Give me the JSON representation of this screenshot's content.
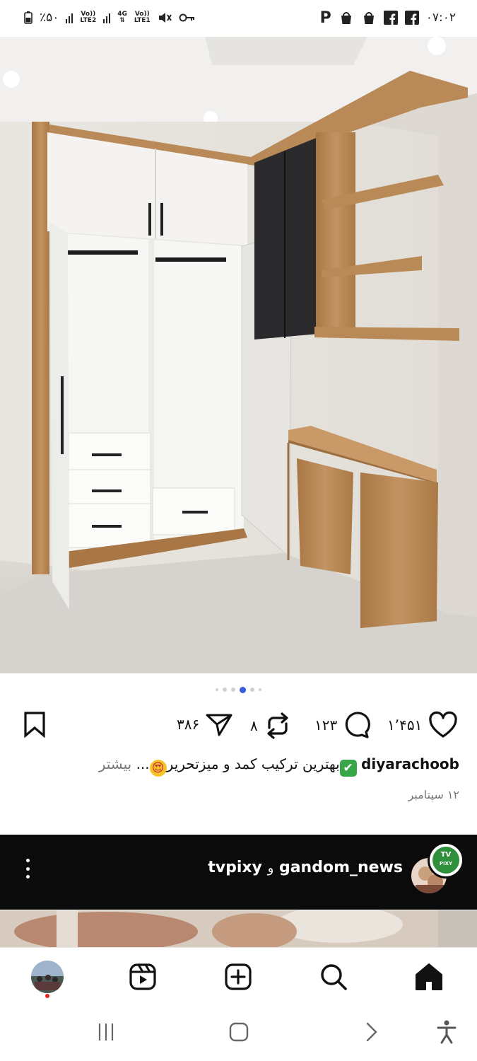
{
  "status_bar": {
    "battery_text": "٪۵۰",
    "net1_label": "Vo)) LTE2",
    "net2_label": "4G LTE1",
    "net2_top": "4G",
    "net2_bottom": "LTE1",
    "net1_top": "Vo))",
    "net1_bottom": "LTE2",
    "net3_top": "Vo))",
    "net3_bottom": "LTE1",
    "time": "۰۷:۰۲",
    "notif_p": "P"
  },
  "post": {
    "carousel": {
      "count": 6,
      "active_index": 4
    },
    "likes": "۱٬۴۵۱",
    "comments": "۱۲۳",
    "reposts": "۸",
    "shares": "۳۸۶",
    "username": "diyarachoob",
    "caption_text": "بهترین ترکیب کمد و میزتحریر",
    "caption_ellipsis": "...",
    "more_label": "بیشتر",
    "date": "۱۲ سپتامبر",
    "check_emoji": "✔",
    "heart_eyes_emoji": "😍"
  },
  "next_post": {
    "user1": "gandom_news",
    "joiner": "و",
    "user2": "tvpixy",
    "logo_text_top": "TV",
    "logo_text_bottom": "PIXY"
  },
  "icons": {
    "like": "heart-outline",
    "comment": "speech-bubble",
    "repost": "repost-arrows",
    "share": "paper-plane",
    "save": "bookmark",
    "menu": "vertical-dots",
    "home": "home",
    "search": "search",
    "create": "plus-square",
    "reels": "reels",
    "profile": "avatar"
  },
  "colors": {
    "dark_bar": "#0b0b0b",
    "active_dot": "#3a5bd9",
    "notification_dot": "#e2242d",
    "wood": "#b98a57"
  }
}
